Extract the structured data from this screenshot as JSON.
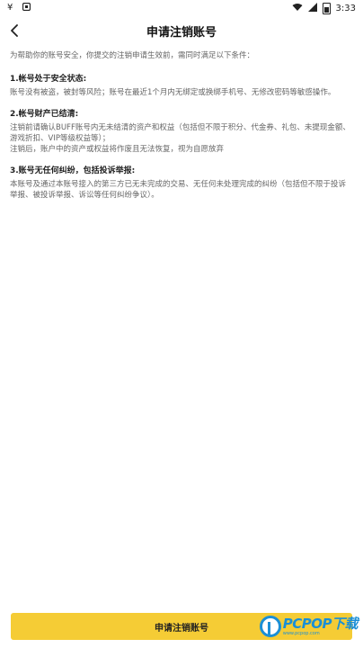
{
  "status_bar": {
    "left_icons": [
      "wallet-icon",
      "square-app-icon"
    ],
    "time": "3:33",
    "right_icons": [
      "wifi-icon",
      "signal-icon",
      "battery-icon"
    ]
  },
  "header": {
    "title": "申请注销账号"
  },
  "content": {
    "intro": "为帮助你的账号安全，你提交的注销申请生效前，需同时满足以下条件：",
    "sections": [
      {
        "title": "1.帐号处于安全状态:",
        "body": [
          "账号没有被盗，被封等风险；账号在最近1个月内无绑定或换绑手机号、无修改密码等敏感操作。"
        ]
      },
      {
        "title": "2.帐号财产已结清:",
        "body": [
          "注销前请确认BUFF账号内无未结清的资产和权益（包括但不限于积分、代金券、礼包、未提现金额、游戏折扣、VIP等级权益等）；",
          "注销后，账户中的资产或权益将作废且无法恢复，视为自愿放弃"
        ]
      },
      {
        "title": "3.账号无任何纠纷，包括投诉举报:",
        "body": [
          "本账号及通过本账号接入的第三方已无未完成的交易、无任何未处理完成的纠纷（包括但不限于投诉举报、被投诉举报、诉讼等任何纠纷争议）。"
        ]
      }
    ]
  },
  "bottom_button": {
    "label": "申请注销账号"
  },
  "watermark": {
    "brand": "PCPOP",
    "brand_cn": "下载",
    "sub": "www.pcpop.com"
  },
  "colors": {
    "accent": "#f5cc35",
    "watermark": "#1b8fd6"
  }
}
